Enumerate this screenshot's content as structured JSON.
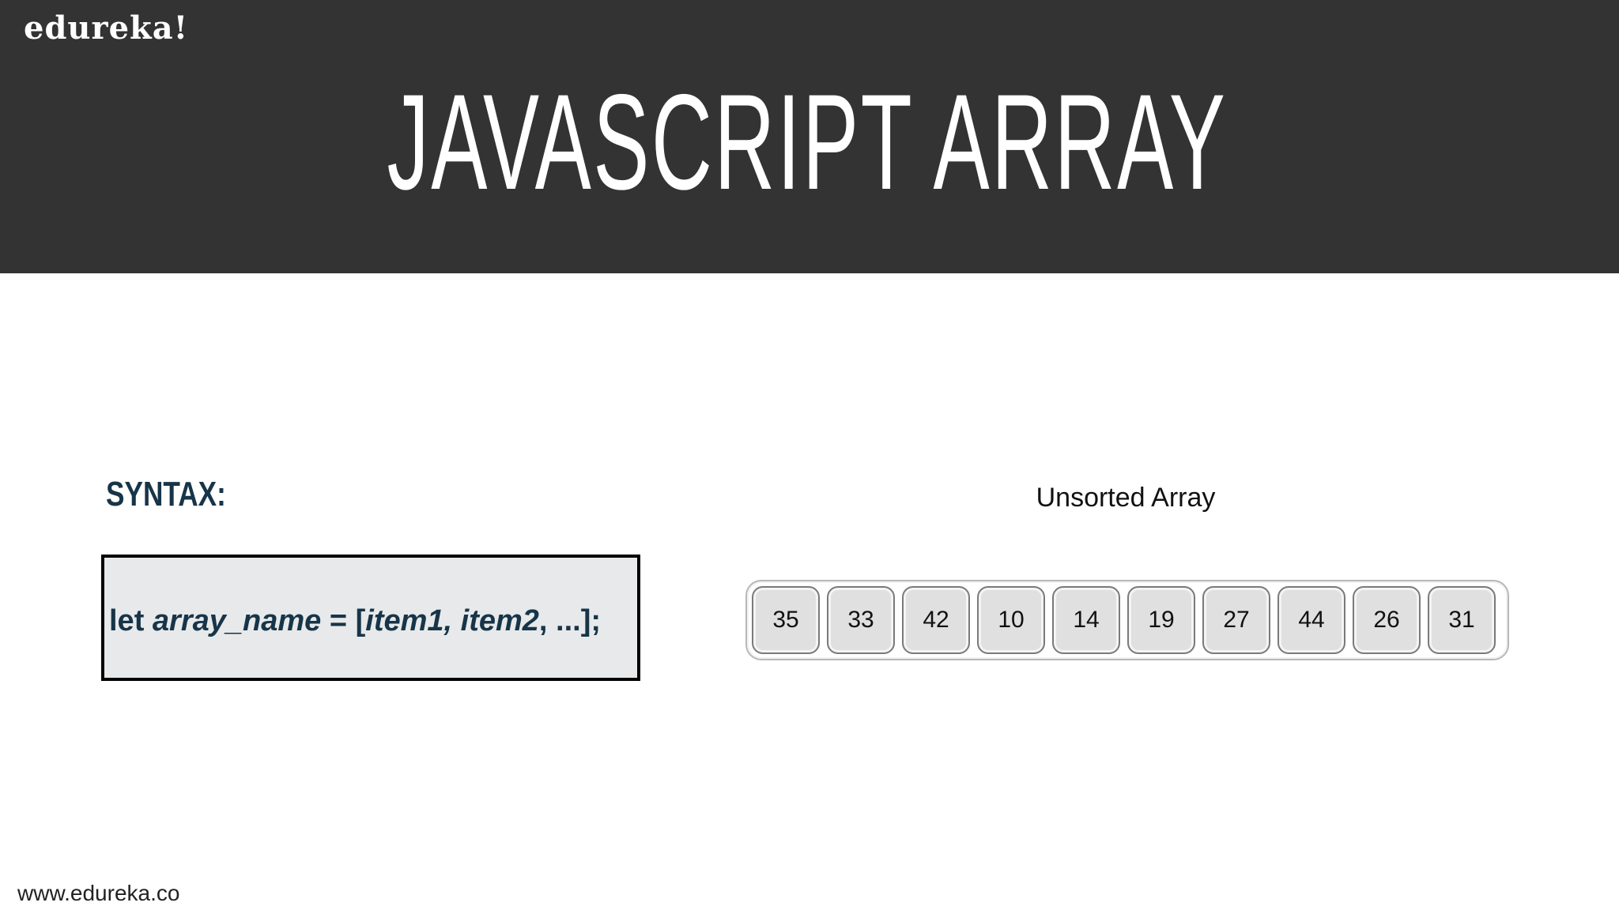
{
  "header": {
    "logo": "edureka!",
    "title": "JAVASCRIPT ARRAY"
  },
  "syntax": {
    "heading": "SYNTAX:",
    "code_prefix": "let ",
    "code_var": "array_name",
    "code_eq": " = [",
    "code_items": "item1, item2",
    "code_suffix": ", ...];"
  },
  "array_figure": {
    "title": "Unsorted Array",
    "values": [
      "35",
      "33",
      "42",
      "10",
      "14",
      "19",
      "27",
      "44",
      "26",
      "31"
    ]
  },
  "footer": {
    "url": "www.edureka.co"
  },
  "colors": {
    "header_bg": "#333333",
    "heading_text": "#173549",
    "code_box_bg": "#e8e9ea"
  }
}
